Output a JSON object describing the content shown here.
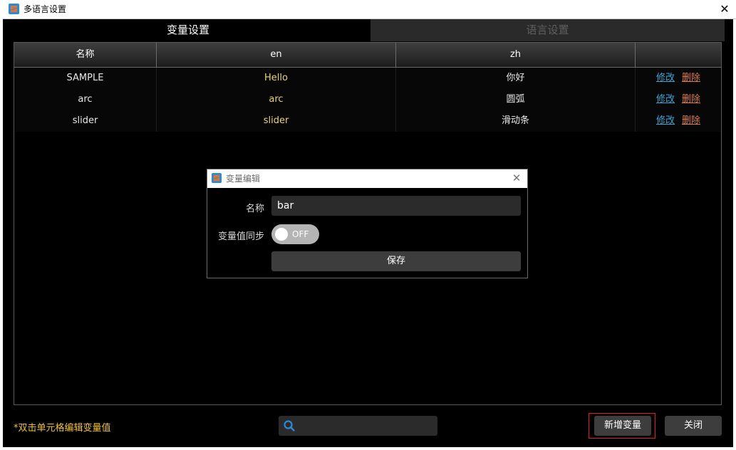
{
  "window": {
    "title": "多语言设置"
  },
  "tabs": [
    {
      "label": "变量设置",
      "active": true
    },
    {
      "label": "语言设置",
      "active": false
    }
  ],
  "table": {
    "columns": [
      "名称",
      "en",
      "zh",
      ""
    ],
    "rows": [
      {
        "name": "SAMPLE",
        "en": "Hello",
        "zh": "你好",
        "edit": "修改",
        "delete": "删除"
      },
      {
        "name": "arc",
        "en": "arc",
        "zh": "圆弧",
        "edit": "修改",
        "delete": "删除"
      },
      {
        "name": "slider",
        "en": "slider",
        "zh": "滑动条",
        "edit": "修改",
        "delete": "删除"
      }
    ]
  },
  "dialog": {
    "title": "变量编辑",
    "name_label": "名称",
    "name_value": "bar",
    "sync_label": "变量值同步",
    "sync_toggle": {
      "state": "OFF",
      "on": false
    },
    "save_label": "保存"
  },
  "footer": {
    "hint": "*双击单元格编辑变量值",
    "search_placeholder": "",
    "add_label": "新增变量",
    "close_label": "关闭"
  },
  "colors": {
    "en_text": "#e8d37a",
    "edit_link": "#3aa6d8",
    "delete_link": "#e07a4a",
    "hint": "#f0c23a",
    "focus_border": "#e02020",
    "icon_blue": "#2a8ad8",
    "icon_orange": "#e8742a"
  },
  "icons": {
    "app": "app-logo-icon",
    "close": "close-icon",
    "search": "search-icon"
  }
}
